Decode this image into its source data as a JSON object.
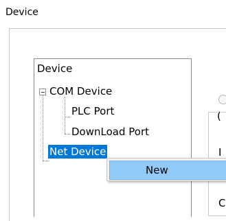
{
  "window": {
    "title": "Device"
  },
  "tree": {
    "root": {
      "label": "Device"
    },
    "com_device": {
      "label": "COM Device",
      "children": [
        {
          "label": "PLC Port"
        },
        {
          "label": "DownLoad Port"
        }
      ]
    },
    "net_device": {
      "label": "Net Device"
    }
  },
  "context_menu": {
    "items": [
      {
        "label": "New"
      }
    ]
  },
  "right_panel": {
    "fragments": [
      "(",
      "I",
      "C"
    ]
  },
  "colors": {
    "selection": "#0078d7",
    "menu_highlight": "#91c9f7"
  }
}
